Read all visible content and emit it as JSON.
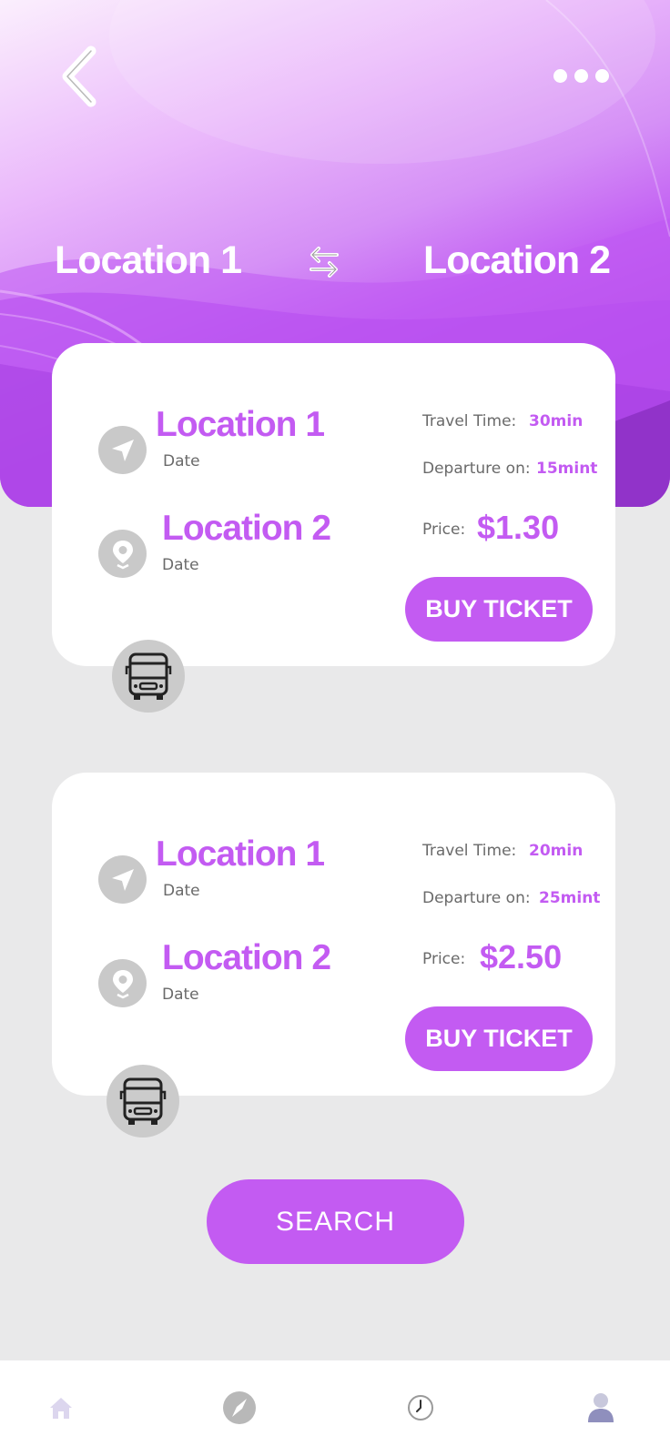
{
  "header": {
    "from": "Location 1",
    "to": "Location 2",
    "back_icon": "chevron-left-icon",
    "more_icon": "more-dots-icon",
    "swap_icon": "swap-arrows-icon"
  },
  "tickets": [
    {
      "from": "Location 1",
      "from_date": "Date",
      "to": "Location 2",
      "to_date": "Date",
      "travel_time_label": "Travel  Time:",
      "travel_time": "30min",
      "departure_label": "Departure on:",
      "departure": "15mint",
      "price_label": "Price:",
      "price": "$1.30",
      "buy_label": "BUY TICKET"
    },
    {
      "from": "Location 1",
      "from_date": "Date",
      "to": "Location 2",
      "to_date": "Date",
      "travel_time_label": "Travel  Time:",
      "travel_time": "20min",
      "departure_label": "Departure on:",
      "departure": "25mint",
      "price_label": "Price:",
      "price": "$2.50",
      "buy_label": "BUY TICKET"
    }
  ],
  "search_label": "SEARCH",
  "nav": [
    "home-icon",
    "compass-icon",
    "clock-icon",
    "user-icon"
  ],
  "colors": {
    "accent": "#c35bf2",
    "background": "#e9e9ea",
    "icon_gray": "#c9c9c9"
  }
}
